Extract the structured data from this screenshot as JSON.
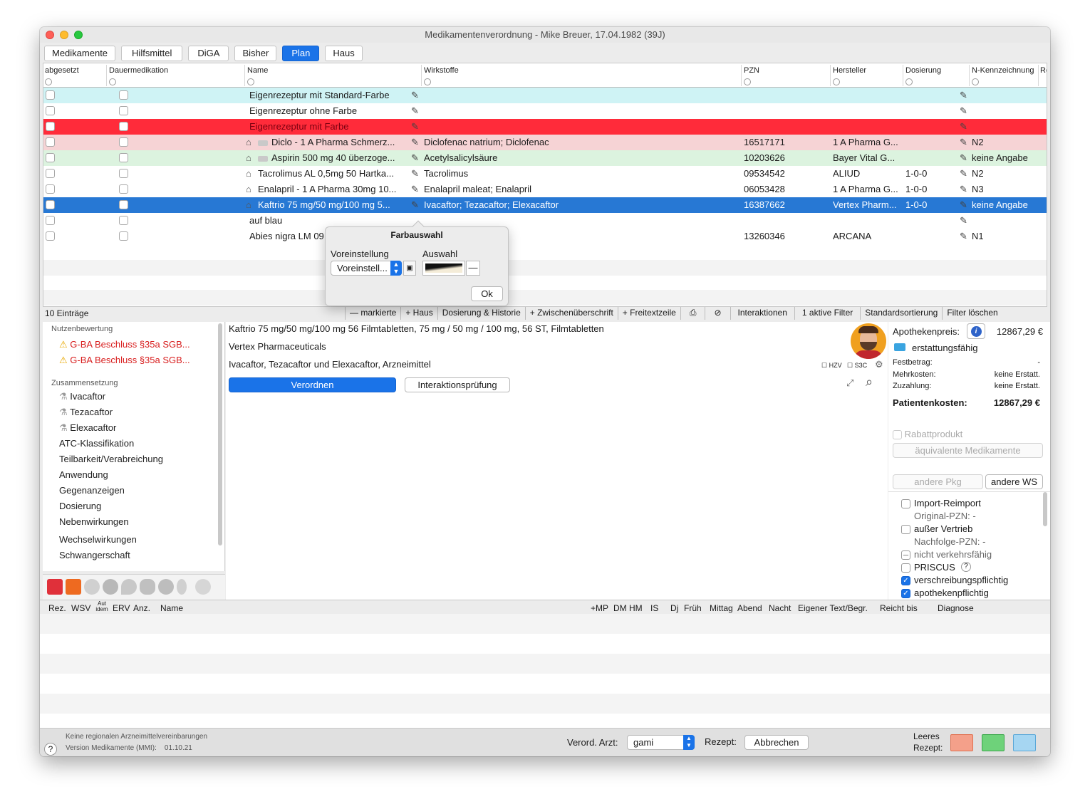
{
  "window": {
    "title": "Medikamentenverordnung - Mike Breuer, 17.04.1982 (39J)"
  },
  "tabs": [
    {
      "label": "Medikamente",
      "active": false
    },
    {
      "label": "Hilfsmittel",
      "active": false
    },
    {
      "label": "DiGA",
      "active": false
    },
    {
      "label": "Bisher",
      "active": false
    },
    {
      "label": "Plan",
      "active": true
    },
    {
      "label": "Haus",
      "active": false
    }
  ],
  "grid": {
    "columns": {
      "abgesetzt": "abgesetzt",
      "dauer": "Dauermedikation",
      "name": "Name",
      "wirkstoffe": "Wirkstoffe",
      "pzn": "PZN",
      "hersteller": "Hersteller",
      "dosierung": "Dosierung",
      "nkenn": "N-Kennzeichnung",
      "re": "Re"
    },
    "rows": [
      {
        "name": "Eigenrezeptur mit Standard-Farbe",
        "wirkstoffe": "",
        "pzn": "",
        "hersteller": "",
        "dosierung": "",
        "nkenn": ""
      },
      {
        "name": "Eigenrezeptur ohne Farbe",
        "wirkstoffe": "",
        "pzn": "",
        "hersteller": "",
        "dosierung": "",
        "nkenn": ""
      },
      {
        "name": "Eigenrezeptur mit Farbe",
        "wirkstoffe": "",
        "pzn": "",
        "hersteller": "",
        "dosierung": "",
        "nkenn": ""
      },
      {
        "name": "Diclo - 1 A Pharma Schmerz...",
        "wirkstoffe": "Diclofenac natrium; Diclofenac",
        "pzn": "16517171",
        "hersteller": "1 A Pharma G...",
        "dosierung": "",
        "nkenn": "N2"
      },
      {
        "name": "Aspirin 500 mg 40 überzoge...",
        "wirkstoffe": "Acetylsalicylsäure",
        "pzn": "10203626",
        "hersteller": "Bayer Vital G...",
        "dosierung": "",
        "nkenn": "keine Angabe"
      },
      {
        "name": "Tacrolimus AL 0,5mg 50 Hartka...",
        "wirkstoffe": "Tacrolimus",
        "pzn": "09534542",
        "hersteller": "ALIUD",
        "dosierung": "1-0-0",
        "nkenn": "N2"
      },
      {
        "name": "Enalapril - 1 A Pharma 30mg 10...",
        "wirkstoffe": "Enalapril maleat; Enalapril",
        "pzn": "06053428",
        "hersteller": "1 A Pharma G...",
        "dosierung": "1-0-0",
        "nkenn": "N3"
      },
      {
        "name": "Kaftrio 75 mg/50 mg/100 mg 5...",
        "wirkstoffe": "Ivacaftor; Tezacaftor; Elexacaftor",
        "pzn": "16387662",
        "hersteller": "Vertex Pharm...",
        "dosierung": "1-0-0",
        "nkenn": "keine Angabe"
      },
      {
        "name": "auf blau",
        "wirkstoffe": "",
        "pzn": "",
        "hersteller": "",
        "dosierung": "",
        "nkenn": ""
      },
      {
        "name": "Abies nigra LM 09",
        "wirkstoffe": "",
        "pzn": "13260346",
        "hersteller": "ARCANA",
        "dosierung": "",
        "nkenn": "N1"
      }
    ]
  },
  "popover": {
    "title": "Farbauswahl",
    "preset_label": "Voreinstellung",
    "choice_label": "Auswahl",
    "preset_value": "Voreinstell...",
    "minus": "—",
    "ok": "Ok"
  },
  "statusbar": {
    "count": "10 Einträge",
    "buttons": [
      "— markierte",
      "+ Haus",
      "Dosierung & Historie",
      "+ Zwischenüberschrift",
      "+ Freitextzeile",
      "⎙",
      "⊘",
      "Interaktionen",
      "1 aktive Filter",
      "Standardsortierung",
      "Filter löschen"
    ]
  },
  "left": {
    "nutzen_head": "Nutzenbewertung",
    "gba1": "G-BA Beschluss §35a SGB...",
    "gba2": "G-BA Beschluss §35a SGB...",
    "zus_head": "Zusammensetzung",
    "comp": [
      "Ivacaftor",
      "Tezacaftor",
      "Elexacaftor"
    ],
    "items": [
      "ATC-Klassifikation",
      "Teilbarkeit/Verabreichung",
      "Anwendung",
      "Gegenanzeigen",
      "Dosierung",
      "Nebenwirkungen",
      "Wechselwirkungen",
      "Schwangerschaft"
    ]
  },
  "detail": {
    "line1": "Kaftrio 75 mg/50 mg/100 mg 56 Filmtabletten, 75 mg / 50 mg / 100 mg, 56 ST, Filmtabletten",
    "line2": "Vertex Pharmaceuticals",
    "line3": "Ivacaftor, Tezacaftor und Elexacaftor, Arzneimittel",
    "hzv": "HZV",
    "s3c": "S3C",
    "verordnen": "Verordnen",
    "interaktion": "Interaktionsprüfung"
  },
  "price": {
    "apo_label": "Apothekenpreis:",
    "apo_value": "12867,29 €",
    "erstattung": "erstattungsfähig",
    "fest_label": "Festbetrag:",
    "fest_value": "-",
    "mehr_label": "Mehrkosten:",
    "mehr_value": "keine Erstatt.",
    "zuz_label": "Zuzahlung:",
    "zuz_value": "keine Erstatt.",
    "patient_label": "Patientenkosten:",
    "patient_value": "12867,29 €",
    "rabatt": "Rabattprodukt",
    "aequiv": "äquivalente Medikamente",
    "andere_pkg": "andere Pkg",
    "andere_ws": "andere WS",
    "import": "Import-Reimport",
    "orig": "Original-PZN: -",
    "ausser": "außer Vertrieb",
    "nachfolge": "Nachfolge-PZN: -",
    "nicht": "nicht verkehrsfähig",
    "priscus": "PRISCUS",
    "verschr": "verschreibungspflichtig",
    "apothek": "apothekenpflichtig"
  },
  "bottom": {
    "cols": [
      "Rez.",
      "WSV",
      "Aut idem",
      "ERV",
      "Anz.",
      "Name",
      "+MP",
      "DM",
      "HM",
      "IS",
      "Dj",
      "Früh",
      "Mittag",
      "Abend",
      "Nacht",
      "Eigener Text/Begr.",
      "Reicht bis",
      "Diagnose"
    ]
  },
  "footer": {
    "info1": "Keine regionalen Arzneimittelvereinbarungen",
    "info2": "Version Medikamente (MMI):    01.10.21",
    "help": "?",
    "arzt_label": "Verord. Arzt:",
    "arzt_value": "gami",
    "rezept_label": "Rezept:",
    "abbrechen": "Abbrechen",
    "leeres1": "Leeres",
    "leeres2": "Rezept:"
  },
  "colors": {
    "accent": "#1a73e8",
    "row_red": "#ff2b3a",
    "row_cyan": "#cff3f5",
    "row_pink": "#f6d3d5",
    "row_green": "#dcf3df",
    "selection": "#2778d4"
  }
}
